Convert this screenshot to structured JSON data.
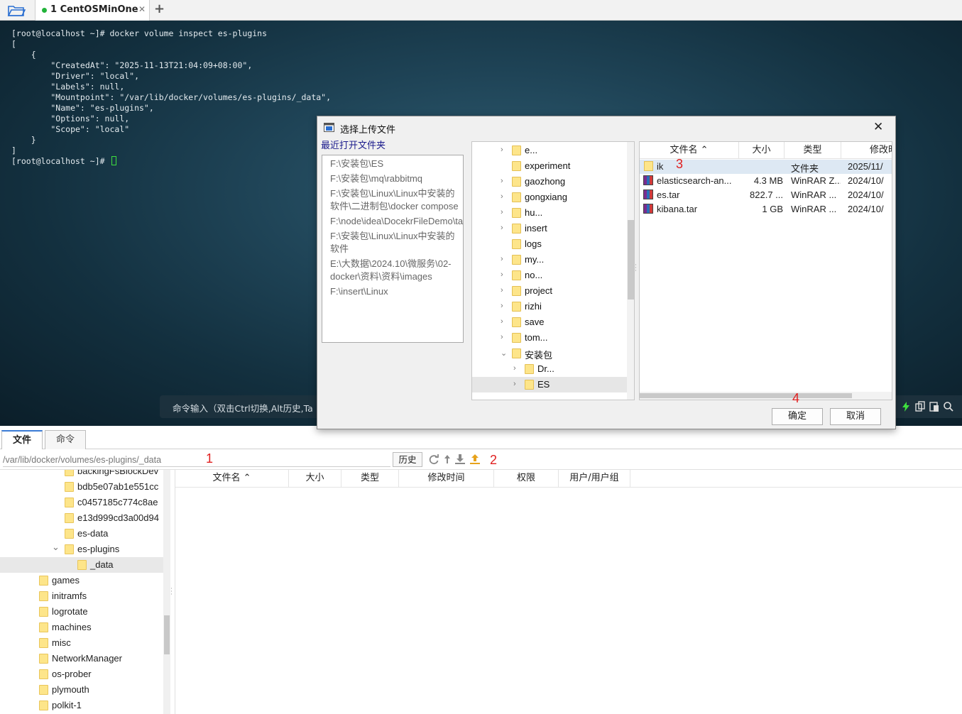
{
  "tabbar": {
    "session_label": "1 CentOSMinOne",
    "close_glyph": "✕",
    "add_glyph": "+"
  },
  "terminal": {
    "lines": [
      "[root@localhost ~]# docker volume inspect es-plugins",
      "[",
      "    {",
      "        \"CreatedAt\": \"2025-11-13T21:04:09+08:00\",",
      "        \"Driver\": \"local\",",
      "        \"Labels\": null,",
      "        \"Mountpoint\": \"/var/lib/docker/volumes/es-plugins/_data\",",
      "        \"Name\": \"es-plugins\",",
      "        \"Options\": null,",
      "        \"Scope\": \"local\"",
      "    }",
      "]",
      "[root@localhost ~]# "
    ],
    "cmd_input_label": "命令输入（双击Ctrl切换,Alt历史,Ta",
    "cursor_color": "#3ee03e"
  },
  "bottom": {
    "tabs": [
      "文件",
      "命令"
    ],
    "path": "/var/lib/docker/volumes/es-plugins/_data",
    "history_label": "历史",
    "tree": [
      {
        "label": "backingFsBlockDev",
        "indent": 2
      },
      {
        "label": "bdb5e07ab1e551cc",
        "indent": 2
      },
      {
        "label": "c0457185c774c8ae",
        "indent": 2
      },
      {
        "label": "e13d999cd3a00d94",
        "indent": 2
      },
      {
        "label": "es-data",
        "indent": 2
      },
      {
        "label": "es-plugins",
        "indent": 2,
        "expanded": true
      },
      {
        "label": "_data",
        "indent": 3,
        "selected": true
      },
      {
        "label": "games",
        "indent": 1
      },
      {
        "label": "initramfs",
        "indent": 1
      },
      {
        "label": "logrotate",
        "indent": 1
      },
      {
        "label": "machines",
        "indent": 1
      },
      {
        "label": "misc",
        "indent": 1
      },
      {
        "label": "NetworkManager",
        "indent": 1
      },
      {
        "label": "os-prober",
        "indent": 1
      },
      {
        "label": "plymouth",
        "indent": 1
      },
      {
        "label": "polkit-1",
        "indent": 1
      }
    ],
    "columns": [
      "文件名",
      "大小",
      "类型",
      "修改时间",
      "权限",
      "用户/用户组"
    ]
  },
  "dialog": {
    "title": "选择上传文件",
    "recent_title": "最近打开文件夹",
    "recent_items": [
      "F:\\安装包\\ES",
      "F:\\安装包\\mq\\rabbitmq",
      "F:\\安装包\\Linux\\Linux中安装的软件\\二进制包\\docker compose",
      "F:\\node\\idea\\DocekrFileDemo\\target",
      "F:\\安装包\\Linux\\Linux中安装的软件",
      "E:\\大数据\\2024.10\\微服务\\02-docker\\资料\\资料\\images",
      "F:\\insert\\Linux"
    ],
    "folder_tree": [
      {
        "label": "e...",
        "chevron": "›",
        "level": 0
      },
      {
        "label": "experiment",
        "chevron": "",
        "level": 0
      },
      {
        "label": "gaozhong",
        "chevron": "›",
        "level": 0
      },
      {
        "label": "gongxiang",
        "chevron": "›",
        "level": 0
      },
      {
        "label": "hu...",
        "chevron": "›",
        "level": 0
      },
      {
        "label": "insert",
        "chevron": "›",
        "level": 0
      },
      {
        "label": "logs",
        "chevron": "",
        "level": 0
      },
      {
        "label": "my...",
        "chevron": "›",
        "level": 0
      },
      {
        "label": "no...",
        "chevron": "›",
        "level": 0
      },
      {
        "label": "project",
        "chevron": "›",
        "level": 0
      },
      {
        "label": "rizhi",
        "chevron": "›",
        "level": 0
      },
      {
        "label": "save",
        "chevron": "›",
        "level": 0
      },
      {
        "label": "tom...",
        "chevron": "›",
        "level": 0
      },
      {
        "label": "安装包",
        "chevron": "⌄",
        "level": 0
      },
      {
        "label": "Dr...",
        "chevron": "›",
        "level": 1
      },
      {
        "label": "ES",
        "chevron": "›",
        "level": 1,
        "selected": true
      }
    ],
    "file_columns": [
      "文件名",
      "大小",
      "类型",
      "修改时"
    ],
    "files": [
      {
        "name": "ik",
        "size": "",
        "type": "文件夹",
        "modified": "2025/11/",
        "kind": "folder"
      },
      {
        "name": "elasticsearch-an...",
        "size": "4.3 MB",
        "type": "WinRAR Z...",
        "modified": "2024/10/",
        "kind": "rar"
      },
      {
        "name": "es.tar",
        "size": "822.7 ...",
        "type": "WinRAR ...",
        "modified": "2024/10/",
        "kind": "rar"
      },
      {
        "name": "kibana.tar",
        "size": "1 GB",
        "type": "WinRAR ...",
        "modified": "2024/10/",
        "kind": "rar"
      }
    ],
    "ok_label": "确定",
    "cancel_label": "取消",
    "close_glyph": "✕"
  },
  "annotations": [
    "1",
    "2",
    "3",
    "4"
  ],
  "colors": {
    "annotation": "#e02020",
    "selected_row": "#dde8f3",
    "folder": "#fde58a"
  }
}
